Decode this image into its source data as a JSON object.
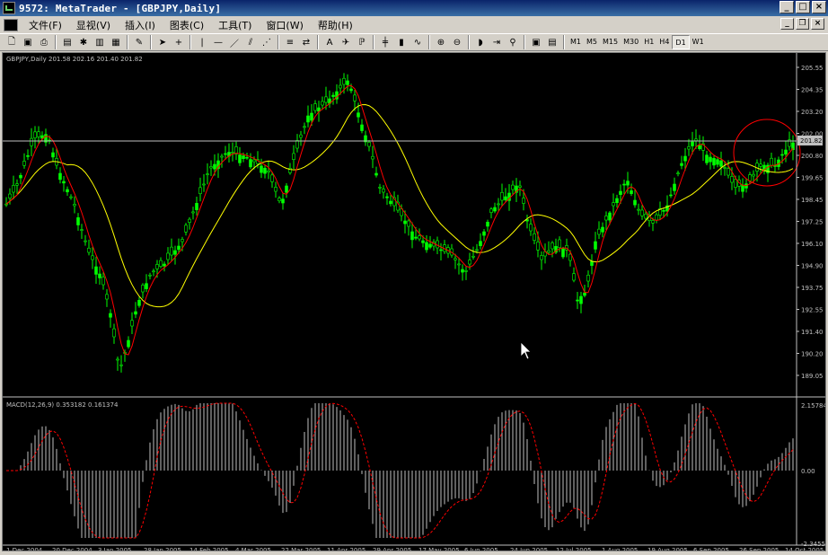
{
  "window": {
    "title": "9572: MetaTrader - [GBPJPY,Daily]"
  },
  "menu": {
    "items": [
      "文件(F)",
      "显视(V)",
      "插入(I)",
      "图表(C)",
      "工具(T)",
      "窗口(W)",
      "帮助(H)"
    ]
  },
  "toolbar": {
    "timeframes": [
      "M1",
      "M5",
      "M15",
      "M30",
      "H1",
      "H4",
      "D1",
      "W1"
    ],
    "active_timeframe": "D1"
  },
  "main_chart": {
    "label": "GBPJPY,Daily  201.58 202.16 201.40 201.82",
    "current_price": "201.82",
    "price_ticks": [
      "205.55",
      "204.35",
      "203.20",
      "202.00",
      "200.80",
      "199.65",
      "198.45",
      "197.25",
      "196.10",
      "194.90",
      "193.75",
      "192.55",
      "191.40",
      "190.20",
      "189.05"
    ],
    "colors": {
      "candles": "#00ff00",
      "fast_ma": "#ff0000",
      "slow_ma": "#ffff00",
      "price_line": "#c0c0c0",
      "circle": "#ff0000"
    }
  },
  "macd": {
    "label": "MACD(12,26,9)  0.353182  0.161374",
    "ticks": [
      "2.15784",
      "0.00",
      "-2.34557"
    ],
    "colors": {
      "histogram": "#c0c0c0",
      "signal": "#ff0000"
    }
  },
  "x_axis": {
    "labels": [
      "1 Dec 2004",
      "20 Dec 2004",
      "3 Jan 2005",
      "28 Jan 2005",
      "14 Feb 2005",
      "4 Mar 2005",
      "22 Mar 2005",
      "11 Apr 2005",
      "29 Apr 2005",
      "17 May 2005",
      "6 Jun 2005",
      "24 Jun 2005",
      "12 Jul 2005",
      "1 Aug 2005",
      "19 Aug 2005",
      "6 Sep 2005",
      "26 Sep 2005",
      "14 Oct 2005"
    ]
  }
}
